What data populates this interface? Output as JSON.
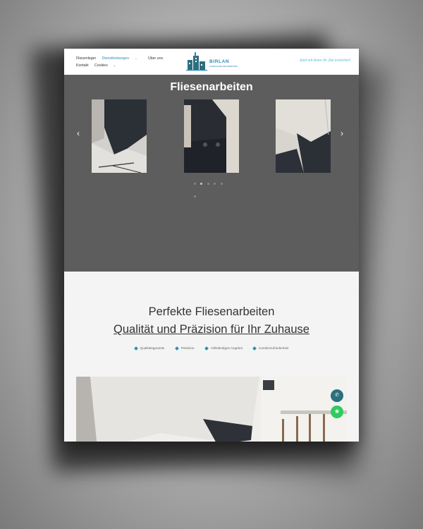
{
  "header": {
    "nav": [
      {
        "label": "Fliesenleger",
        "active": false
      },
      {
        "label": "Dienstleistungen",
        "active": true,
        "dropdown": true
      },
      {
        "label": "Über uns",
        "active": false
      },
      {
        "label": "Kontakt",
        "active": false
      },
      {
        "label": "Cookies",
        "active": false,
        "dropdown": true
      }
    ],
    "logo_text": "BIRLAN",
    "logo_sub": "FLIESENLEGER MEISTERBETRIEB",
    "cta": "Jetzt mit ihnen Ihr Ziel erreichen!"
  },
  "hero": {
    "title": "Fliesenarbeiten",
    "slides": [
      "slide-1",
      "slide-2",
      "slide-3"
    ],
    "prev_icon": "chevron-left-icon",
    "next_icon": "chevron-right-icon",
    "dots": 6,
    "active_dot": 1
  },
  "content": {
    "heading": "Perfekte Fliesenarbeiten",
    "subheading": "Qualität und Präzision für Ihr Zuhause",
    "features": [
      "Qualitätsgarantie",
      "Präzision",
      "Vollständiges Angebot",
      "Kundenzufriedenheit"
    ]
  },
  "floating": {
    "phone_icon": "phone-icon",
    "whatsapp_icon": "whatsapp-icon"
  },
  "colors": {
    "accent": "#2d8bb7",
    "hero_bg": "#5d5d5d",
    "section_bg": "#f4f4f4",
    "whatsapp": "#2ecc5f",
    "phone": "#2c6f7e"
  }
}
